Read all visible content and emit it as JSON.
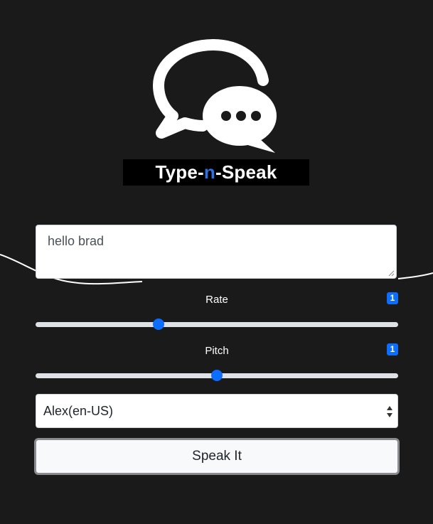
{
  "brand": {
    "prefix": "Type-",
    "accent": "n",
    "suffix": "-Speak",
    "accent_color": "#2f6fe0"
  },
  "text_input": {
    "value": "hello brad"
  },
  "rate": {
    "label": "Rate",
    "badge": "1",
    "level": 0.34
  },
  "pitch": {
    "label": "Pitch",
    "badge": "1",
    "level": 0.5
  },
  "voice_select": {
    "selected": "Alex(en-US)"
  },
  "speak_button": {
    "label": "Speak It"
  },
  "colors": {
    "background": "#1b1a1b",
    "accent": "#0d6efd"
  },
  "icons": [
    "chat-bubbles-logo-icon",
    "resize-grip-icon",
    "select-arrows-icon"
  ]
}
